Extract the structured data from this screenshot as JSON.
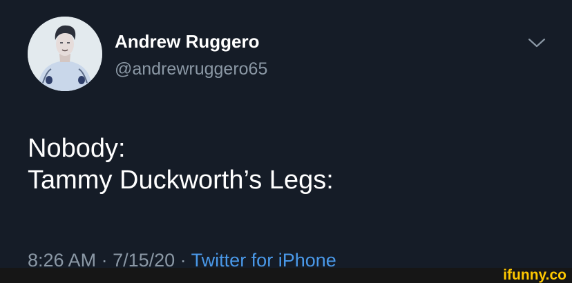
{
  "tweet": {
    "author": {
      "display_name": "Andrew Ruggero",
      "handle": "@andrewruggero65"
    },
    "text_lines": [
      "Nobody:",
      "Tammy Duckworth’s Legs:"
    ],
    "meta": {
      "time": "8:26 AM",
      "separator": " · ",
      "date": "7/15/20",
      "source": "Twitter for iPhone"
    }
  },
  "watermark": {
    "text": "ifunny.co"
  },
  "icons": {
    "menu": "chevron-down-icon"
  },
  "colors": {
    "background": "#151c27",
    "primary_text": "#ffffff",
    "secondary_text": "#8b98a5",
    "link": "#4a99e9",
    "watermark": "#ffc800"
  }
}
